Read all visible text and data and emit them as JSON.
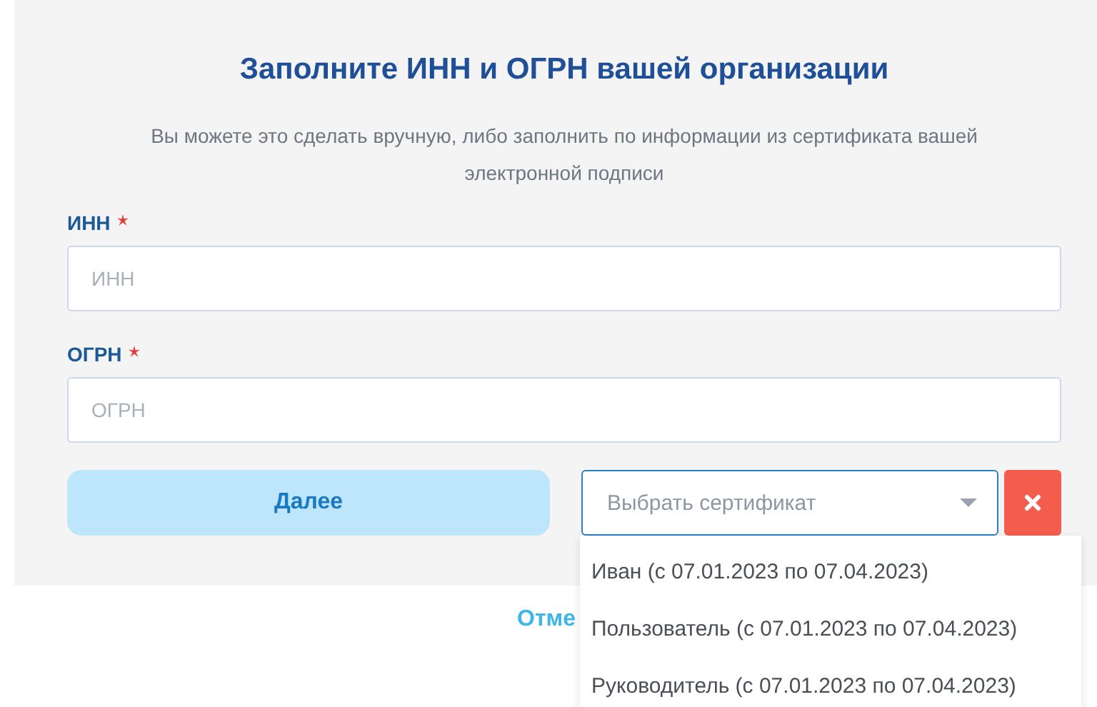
{
  "title": "Заполните ИНН и ОГРН вашей организации",
  "subtitle": "Вы можете это сделать вручную, либо заполнить по информации из сертификата вашей электронной подписи",
  "fields": [
    {
      "label": "ИНН",
      "required": true,
      "placeholder": "ИНН"
    },
    {
      "label": "ОГРН",
      "required": true,
      "placeholder": "ОГРН"
    }
  ],
  "next_button": {
    "label": "Далее",
    "disabled": true
  },
  "certificate_select": {
    "placeholder": "Выбрать сертификат",
    "expanded": true,
    "options": [
      {
        "label": "Иван (с 07.01.2023 по 07.04.2023)"
      },
      {
        "label": "Пользователь (с 07.01.2023 по 07.04.2023)"
      },
      {
        "label": "Руководитель (с 07.01.2023 по 07.04.2023)"
      }
    ]
  },
  "cancel_link": "Отме"
}
